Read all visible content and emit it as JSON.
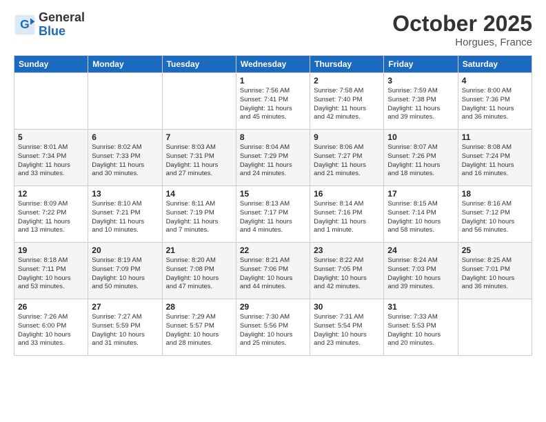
{
  "header": {
    "logo_line1": "General",
    "logo_line2": "Blue",
    "month": "October 2025",
    "location": "Horgues, France"
  },
  "weekdays": [
    "Sunday",
    "Monday",
    "Tuesday",
    "Wednesday",
    "Thursday",
    "Friday",
    "Saturday"
  ],
  "weeks": [
    [
      {
        "day": "",
        "info": ""
      },
      {
        "day": "",
        "info": ""
      },
      {
        "day": "",
        "info": ""
      },
      {
        "day": "1",
        "info": "Sunrise: 7:56 AM\nSunset: 7:41 PM\nDaylight: 11 hours\nand 45 minutes."
      },
      {
        "day": "2",
        "info": "Sunrise: 7:58 AM\nSunset: 7:40 PM\nDaylight: 11 hours\nand 42 minutes."
      },
      {
        "day": "3",
        "info": "Sunrise: 7:59 AM\nSunset: 7:38 PM\nDaylight: 11 hours\nand 39 minutes."
      },
      {
        "day": "4",
        "info": "Sunrise: 8:00 AM\nSunset: 7:36 PM\nDaylight: 11 hours\nand 36 minutes."
      }
    ],
    [
      {
        "day": "5",
        "info": "Sunrise: 8:01 AM\nSunset: 7:34 PM\nDaylight: 11 hours\nand 33 minutes."
      },
      {
        "day": "6",
        "info": "Sunrise: 8:02 AM\nSunset: 7:33 PM\nDaylight: 11 hours\nand 30 minutes."
      },
      {
        "day": "7",
        "info": "Sunrise: 8:03 AM\nSunset: 7:31 PM\nDaylight: 11 hours\nand 27 minutes."
      },
      {
        "day": "8",
        "info": "Sunrise: 8:04 AM\nSunset: 7:29 PM\nDaylight: 11 hours\nand 24 minutes."
      },
      {
        "day": "9",
        "info": "Sunrise: 8:06 AM\nSunset: 7:27 PM\nDaylight: 11 hours\nand 21 minutes."
      },
      {
        "day": "10",
        "info": "Sunrise: 8:07 AM\nSunset: 7:26 PM\nDaylight: 11 hours\nand 18 minutes."
      },
      {
        "day": "11",
        "info": "Sunrise: 8:08 AM\nSunset: 7:24 PM\nDaylight: 11 hours\nand 16 minutes."
      }
    ],
    [
      {
        "day": "12",
        "info": "Sunrise: 8:09 AM\nSunset: 7:22 PM\nDaylight: 11 hours\nand 13 minutes."
      },
      {
        "day": "13",
        "info": "Sunrise: 8:10 AM\nSunset: 7:21 PM\nDaylight: 11 hours\nand 10 minutes."
      },
      {
        "day": "14",
        "info": "Sunrise: 8:11 AM\nSunset: 7:19 PM\nDaylight: 11 hours\nand 7 minutes."
      },
      {
        "day": "15",
        "info": "Sunrise: 8:13 AM\nSunset: 7:17 PM\nDaylight: 11 hours\nand 4 minutes."
      },
      {
        "day": "16",
        "info": "Sunrise: 8:14 AM\nSunset: 7:16 PM\nDaylight: 11 hours\nand 1 minute."
      },
      {
        "day": "17",
        "info": "Sunrise: 8:15 AM\nSunset: 7:14 PM\nDaylight: 10 hours\nand 58 minutes."
      },
      {
        "day": "18",
        "info": "Sunrise: 8:16 AM\nSunset: 7:12 PM\nDaylight: 10 hours\nand 56 minutes."
      }
    ],
    [
      {
        "day": "19",
        "info": "Sunrise: 8:18 AM\nSunset: 7:11 PM\nDaylight: 10 hours\nand 53 minutes."
      },
      {
        "day": "20",
        "info": "Sunrise: 8:19 AM\nSunset: 7:09 PM\nDaylight: 10 hours\nand 50 minutes."
      },
      {
        "day": "21",
        "info": "Sunrise: 8:20 AM\nSunset: 7:08 PM\nDaylight: 10 hours\nand 47 minutes."
      },
      {
        "day": "22",
        "info": "Sunrise: 8:21 AM\nSunset: 7:06 PM\nDaylight: 10 hours\nand 44 minutes."
      },
      {
        "day": "23",
        "info": "Sunrise: 8:22 AM\nSunset: 7:05 PM\nDaylight: 10 hours\nand 42 minutes."
      },
      {
        "day": "24",
        "info": "Sunrise: 8:24 AM\nSunset: 7:03 PM\nDaylight: 10 hours\nand 39 minutes."
      },
      {
        "day": "25",
        "info": "Sunrise: 8:25 AM\nSunset: 7:01 PM\nDaylight: 10 hours\nand 36 minutes."
      }
    ],
    [
      {
        "day": "26",
        "info": "Sunrise: 7:26 AM\nSunset: 6:00 PM\nDaylight: 10 hours\nand 33 minutes."
      },
      {
        "day": "27",
        "info": "Sunrise: 7:27 AM\nSunset: 5:59 PM\nDaylight: 10 hours\nand 31 minutes."
      },
      {
        "day": "28",
        "info": "Sunrise: 7:29 AM\nSunset: 5:57 PM\nDaylight: 10 hours\nand 28 minutes."
      },
      {
        "day": "29",
        "info": "Sunrise: 7:30 AM\nSunset: 5:56 PM\nDaylight: 10 hours\nand 25 minutes."
      },
      {
        "day": "30",
        "info": "Sunrise: 7:31 AM\nSunset: 5:54 PM\nDaylight: 10 hours\nand 23 minutes."
      },
      {
        "day": "31",
        "info": "Sunrise: 7:33 AM\nSunset: 5:53 PM\nDaylight: 10 hours\nand 20 minutes."
      },
      {
        "day": "",
        "info": ""
      }
    ]
  ]
}
